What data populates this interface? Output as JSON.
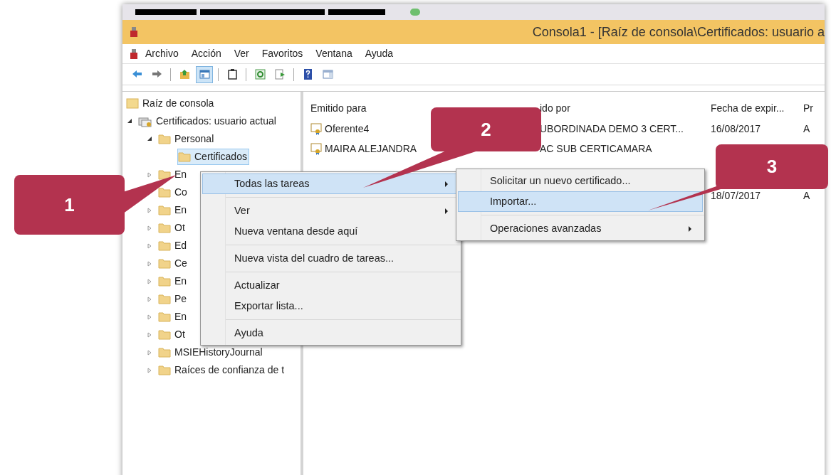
{
  "window": {
    "title": "Consola1 - [Raíz de consola\\Certificados: usuario a"
  },
  "menu_bar": [
    "Archivo",
    "Acción",
    "Ver",
    "Favoritos",
    "Ventana",
    "Ayuda"
  ],
  "toolbar": [
    {
      "kind": "back",
      "pressed": false
    },
    {
      "kind": "forward",
      "pressed": false
    },
    {
      "kind": "separator"
    },
    {
      "kind": "up",
      "pressed": false
    },
    {
      "kind": "tree",
      "pressed": true
    },
    {
      "kind": "separator"
    },
    {
      "kind": "properties",
      "pressed": false
    },
    {
      "kind": "separator"
    },
    {
      "kind": "refresh",
      "pressed": false
    },
    {
      "kind": "export",
      "pressed": false
    },
    {
      "kind": "separator"
    },
    {
      "kind": "help",
      "pressed": false
    },
    {
      "kind": "pane",
      "pressed": false
    }
  ],
  "tree": [
    {
      "label": "Raíz de consola",
      "kind": "root",
      "selected": false,
      "children": [
        {
          "label": "Certificados: usuario actual",
          "kind": "store",
          "expanded": true,
          "selected": false,
          "children": [
            {
              "label": "Personal",
              "kind": "folder",
              "expanded": true,
              "selected": false,
              "children": [
                {
                  "label": "Certificados",
                  "kind": "folder",
                  "selected": true
                }
              ]
            },
            {
              "label": "En",
              "kind": "folder",
              "expanded": false,
              "selected": false
            },
            {
              "label": "Co",
              "kind": "folder",
              "expanded": false,
              "selected": false
            },
            {
              "label": "En",
              "kind": "folder",
              "expanded": false,
              "selected": false
            },
            {
              "label": "Ot",
              "kind": "folder",
              "expanded": false,
              "selected": false
            },
            {
              "label": "Ed",
              "kind": "folder",
              "expanded": false,
              "selected": false
            },
            {
              "label": "Ce",
              "kind": "folder",
              "expanded": false,
              "selected": false
            },
            {
              "label": "En",
              "kind": "folder",
              "expanded": false,
              "selected": false
            },
            {
              "label": "Pe",
              "kind": "folder",
              "expanded": false,
              "selected": false
            },
            {
              "label": "En",
              "kind": "folder",
              "expanded": false,
              "selected": false
            },
            {
              "label": "Ot",
              "kind": "folder",
              "expanded": false,
              "selected": false
            },
            {
              "label": "MSIEHistoryJournal",
              "kind": "folder",
              "expanded": false,
              "selected": false
            },
            {
              "label": "Raíces de confianza de t",
              "kind": "folder",
              "expanded": false,
              "selected": false
            }
          ]
        }
      ]
    }
  ],
  "table": {
    "columns": [
      "Emitido para",
      "ido por",
      "Fecha de expir...",
      "Pr"
    ],
    "rows": [
      {
        "column_1": "Oferente4",
        "column_2": "UBORDINADA DEMO 3 CERT...",
        "column_3": "16/08/2017",
        "column_4": "A"
      },
      {
        "column_1": "MAIRA ALEJANDRA",
        "column_2": "AC SUB CERTICAMARA"
      },
      {
        "column_3": "18/07/2017",
        "column_4": "A"
      }
    ]
  },
  "context_menu": [
    {
      "kind": "item",
      "label": "Todas las tareas",
      "submenu": true,
      "selected": true
    },
    {
      "kind": "separator"
    },
    {
      "kind": "item",
      "label": "Ver",
      "submenu": true,
      "selected": false
    },
    {
      "kind": "item",
      "label": "Nueva ventana desde aquí",
      "submenu": false,
      "selected": false
    },
    {
      "kind": "separator"
    },
    {
      "kind": "item",
      "label": "Nueva vista del cuadro de tareas...",
      "submenu": false,
      "selected": false
    },
    {
      "kind": "separator"
    },
    {
      "kind": "item",
      "label": "Actualizar",
      "submenu": false,
      "selected": false
    },
    {
      "kind": "item",
      "label": "Exportar lista...",
      "submenu": false,
      "selected": false
    },
    {
      "kind": "separator"
    },
    {
      "kind": "item",
      "label": "Ayuda",
      "submenu": false,
      "selected": false
    }
  ],
  "submenu": [
    {
      "kind": "item",
      "label": "Solicitar un nuevo certificado...",
      "submenu": false,
      "selected": false
    },
    {
      "kind": "item",
      "label": "Importar...",
      "submenu": false,
      "selected": true
    },
    {
      "kind": "separator"
    },
    {
      "kind": "item",
      "label": "Operaciones avanzadas",
      "submenu": true,
      "selected": false
    }
  ],
  "callouts": [
    {
      "number": "1"
    },
    {
      "number": "2"
    },
    {
      "number": "3"
    }
  ]
}
